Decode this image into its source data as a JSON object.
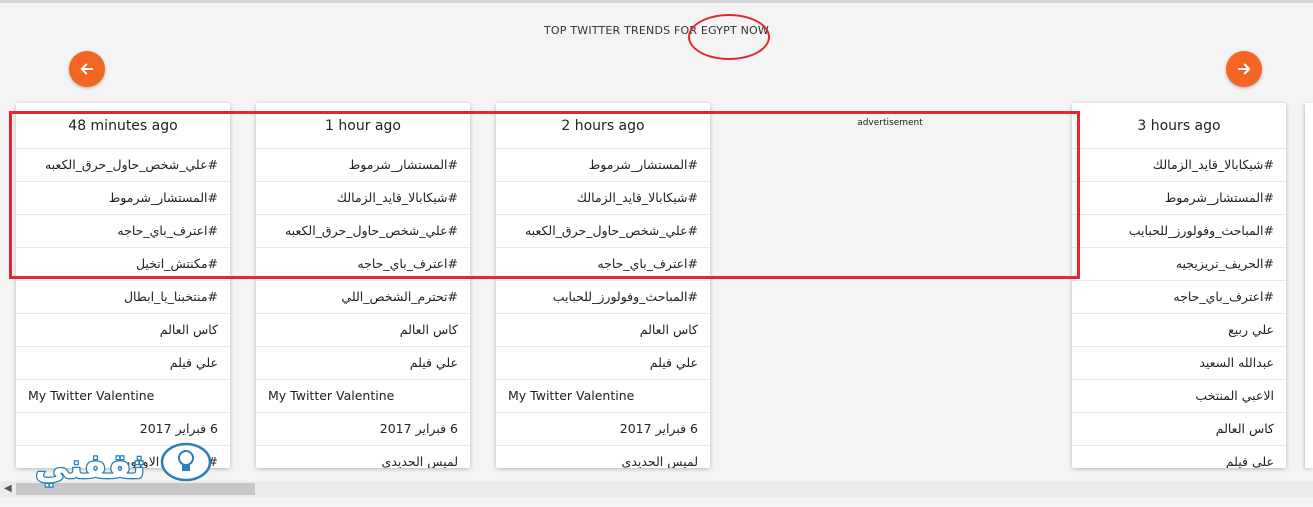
{
  "header": {
    "title": "TOP TWITTER TRENDS FOR EGYPT NOW"
  },
  "colors": {
    "accent": "#f26522",
    "annotation": "#e52530"
  },
  "nav": {
    "prev_icon": "arrow-left-icon",
    "next_icon": "arrow-right-icon"
  },
  "ad": {
    "label": "advertisement"
  },
  "logo": {
    "text": "ثقفني"
  },
  "columns": [
    {
      "time": "48 minutes ago",
      "trends": [
        "#علي_شخص_حاول_حرق_الكعبه",
        "#المستشار_شرموط",
        "#اعترف_باي_حاجه",
        "#مكنتش_اتخيل",
        "#منتخبنا_يا_ابطال",
        "كاس العالم",
        "علي فيلم",
        "My Twitter Valentine",
        "6 فبراير 2017",
        "#السحاب_الاوروبي"
      ]
    },
    {
      "time": "1 hour ago",
      "trends": [
        "#المستشار_شرموط",
        "#شيكابالا_قايد_الزمالك",
        "#علي_شخص_حاول_حرق_الكعبه",
        "#اعترف_باي_حاجه",
        "#تحترم_الشخص_اللي",
        "كاس العالم",
        "علي فيلم",
        "My Twitter Valentine",
        "6 فبراير 2017",
        "لميس الحديدي"
      ]
    },
    {
      "time": "2 hours ago",
      "trends": [
        "#المستشار_شرموط",
        "#شيكابالا_قايد_الزمالك",
        "#علي_شخص_حاول_حرق_الكعبه",
        "#اعترف_باي_حاجه",
        "#المباحث_وفولورز_للحبايب",
        "كاس العالم",
        "علي فيلم",
        "My Twitter Valentine",
        "6 فبراير 2017",
        "لميس الحديدي"
      ]
    },
    {
      "time": "3 hours ago",
      "trends": [
        "#شيكابالا_قايد_الزمالك",
        "#المستشار_شرموط",
        "#المباحث_وفولورز_للحبايب",
        "#الحريف_تريزيجيه",
        "#اعترف_باي_حاجه",
        "علي ربيع",
        "عبدالله السعيد",
        "الاعبي المنتخب",
        "كاس العالم",
        "علي فيلم"
      ]
    }
  ]
}
